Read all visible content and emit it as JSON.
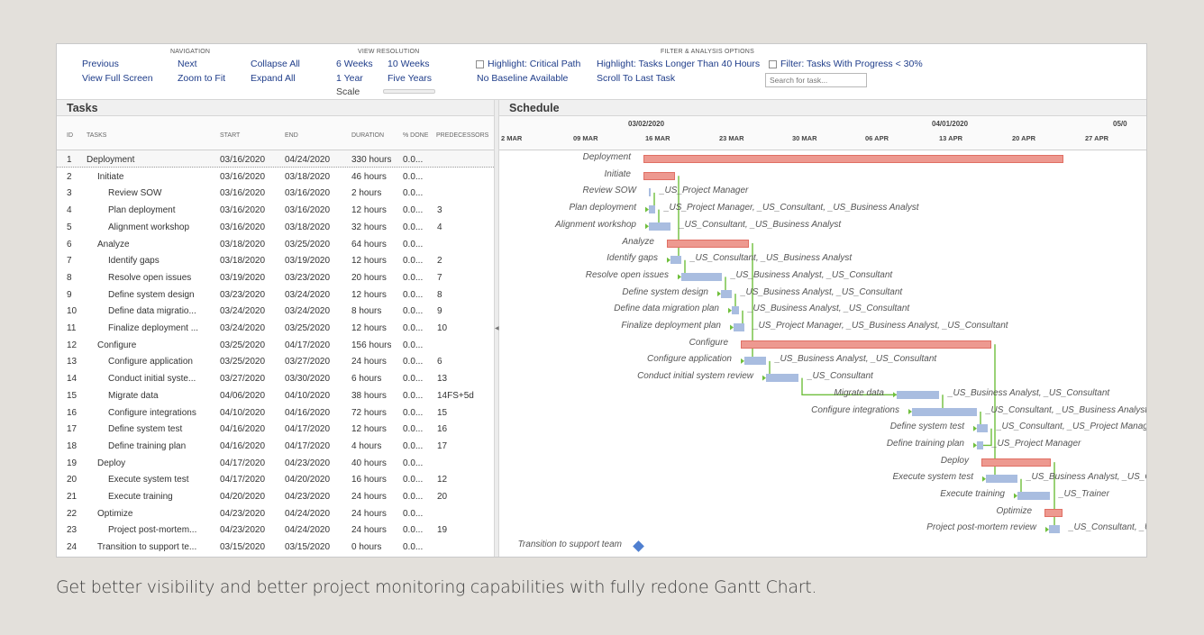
{
  "toolbar": {
    "navigation": {
      "title": "NAVIGATION",
      "previous": "Previous",
      "next": "Next",
      "collapse_all": "Collapse All",
      "view_full_screen": "View Full Screen",
      "zoom_to_fit": "Zoom to Fit",
      "expand_all": "Expand All"
    },
    "view_resolution": {
      "title": "VIEW RESOLUTION",
      "six_weeks": "6 Weeks",
      "ten_weeks": "10 Weeks",
      "one_year": "1 Year",
      "five_years": "Five Years",
      "scale": "Scale"
    },
    "filter": {
      "title": "FILTER & ANALYSIS OPTIONS",
      "highlight_critical": "Highlight: Critical Path",
      "highlight_longer": "Highlight: Tasks Longer Than 40 Hours",
      "filter_progress": "Filter: Tasks With Progress < 30%",
      "no_baseline": "No Baseline Available",
      "scroll_last": "Scroll To Last Task",
      "search_placeholder": "Search for task..."
    }
  },
  "tasks_panel": {
    "title": "Tasks",
    "columns": {
      "id": "ID",
      "tasks": "TASKS",
      "start": "START",
      "end": "END",
      "duration": "DURATION",
      "done": "% DONE",
      "pred": "PREDECESSORS"
    },
    "rows": [
      {
        "id": "1",
        "name": "Deployment",
        "start": "03/16/2020",
        "end": "04/24/2020",
        "duration": "330 hours",
        "done": "0.0...",
        "pred": "",
        "indent": 0
      },
      {
        "id": "2",
        "name": "Initiate",
        "start": "03/16/2020",
        "end": "03/18/2020",
        "duration": "46 hours",
        "done": "0.0...",
        "pred": "",
        "indent": 1
      },
      {
        "id": "3",
        "name": "Review SOW",
        "start": "03/16/2020",
        "end": "03/16/2020",
        "duration": "2 hours",
        "done": "0.0...",
        "pred": "",
        "indent": 2
      },
      {
        "id": "4",
        "name": "Plan deployment",
        "start": "03/16/2020",
        "end": "03/16/2020",
        "duration": "12 hours",
        "done": "0.0...",
        "pred": "3",
        "indent": 2
      },
      {
        "id": "5",
        "name": "Alignment workshop",
        "start": "03/16/2020",
        "end": "03/18/2020",
        "duration": "32 hours",
        "done": "0.0...",
        "pred": "4",
        "indent": 2
      },
      {
        "id": "6",
        "name": "Analyze",
        "start": "03/18/2020",
        "end": "03/25/2020",
        "duration": "64 hours",
        "done": "0.0...",
        "pred": "",
        "indent": 1
      },
      {
        "id": "7",
        "name": "Identify gaps",
        "start": "03/18/2020",
        "end": "03/19/2020",
        "duration": "12 hours",
        "done": "0.0...",
        "pred": "2",
        "indent": 2
      },
      {
        "id": "8",
        "name": "Resolve open issues",
        "start": "03/19/2020",
        "end": "03/23/2020",
        "duration": "20 hours",
        "done": "0.0...",
        "pred": "7",
        "indent": 2
      },
      {
        "id": "9",
        "name": "Define system design",
        "start": "03/23/2020",
        "end": "03/24/2020",
        "duration": "12 hours",
        "done": "0.0...",
        "pred": "8",
        "indent": 2
      },
      {
        "id": "10",
        "name": "Define data migratio...",
        "start": "03/24/2020",
        "end": "03/24/2020",
        "duration": "8 hours",
        "done": "0.0...",
        "pred": "9",
        "indent": 2
      },
      {
        "id": "11",
        "name": "Finalize deployment ...",
        "start": "03/24/2020",
        "end": "03/25/2020",
        "duration": "12 hours",
        "done": "0.0...",
        "pred": "10",
        "indent": 2
      },
      {
        "id": "12",
        "name": "Configure",
        "start": "03/25/2020",
        "end": "04/17/2020",
        "duration": "156 hours",
        "done": "0.0...",
        "pred": "",
        "indent": 1
      },
      {
        "id": "13",
        "name": "Configure application",
        "start": "03/25/2020",
        "end": "03/27/2020",
        "duration": "24 hours",
        "done": "0.0...",
        "pred": "6",
        "indent": 2
      },
      {
        "id": "14",
        "name": "Conduct initial syste...",
        "start": "03/27/2020",
        "end": "03/30/2020",
        "duration": "6 hours",
        "done": "0.0...",
        "pred": "13",
        "indent": 2
      },
      {
        "id": "15",
        "name": "Migrate data",
        "start": "04/06/2020",
        "end": "04/10/2020",
        "duration": "38 hours",
        "done": "0.0...",
        "pred": "14FS+5d",
        "indent": 2
      },
      {
        "id": "16",
        "name": "Configure integrations",
        "start": "04/10/2020",
        "end": "04/16/2020",
        "duration": "72 hours",
        "done": "0.0...",
        "pred": "15",
        "indent": 2
      },
      {
        "id": "17",
        "name": "Define system test",
        "start": "04/16/2020",
        "end": "04/17/2020",
        "duration": "12 hours",
        "done": "0.0...",
        "pred": "16",
        "indent": 2
      },
      {
        "id": "18",
        "name": "Define training plan",
        "start": "04/16/2020",
        "end": "04/17/2020",
        "duration": "4 hours",
        "done": "0.0...",
        "pred": "17",
        "indent": 2
      },
      {
        "id": "19",
        "name": "Deploy",
        "start": "04/17/2020",
        "end": "04/23/2020",
        "duration": "40 hours",
        "done": "0.0...",
        "pred": "",
        "indent": 1
      },
      {
        "id": "20",
        "name": "Execute system test",
        "start": "04/17/2020",
        "end": "04/20/2020",
        "duration": "16 hours",
        "done": "0.0...",
        "pred": "12",
        "indent": 2
      },
      {
        "id": "21",
        "name": "Execute training",
        "start": "04/20/2020",
        "end": "04/23/2020",
        "duration": "24 hours",
        "done": "0.0...",
        "pred": "20",
        "indent": 2
      },
      {
        "id": "22",
        "name": "Optimize",
        "start": "04/23/2020",
        "end": "04/24/2020",
        "duration": "24 hours",
        "done": "0.0...",
        "pred": "",
        "indent": 1
      },
      {
        "id": "23",
        "name": "Project post-mortem...",
        "start": "04/23/2020",
        "end": "04/24/2020",
        "duration": "24 hours",
        "done": "0.0...",
        "pred": "19",
        "indent": 2
      },
      {
        "id": "24",
        "name": "Transition to support te...",
        "start": "03/15/2020",
        "end": "03/15/2020",
        "duration": "0 hours",
        "done": "0.0...",
        "pred": "",
        "indent": 1
      }
    ]
  },
  "schedule_panel": {
    "title": "Schedule",
    "months": [
      "03/02/2020",
      "04/01/2020",
      "05/0"
    ],
    "weeks": [
      "2 MAR",
      "09 MAR",
      "16 MAR",
      "23 MAR",
      "30 MAR",
      "06 APR",
      "13 APR",
      "20 APR",
      "27 APR"
    ],
    "rows": [
      {
        "label": "Deployment",
        "type": "summary",
        "resources": ""
      },
      {
        "label": "Initiate",
        "type": "summary",
        "resources": ""
      },
      {
        "label": "Review SOW",
        "type": "task",
        "resources": "_US_Project Manager"
      },
      {
        "label": "Plan deployment",
        "type": "task",
        "resources": "_US_Project Manager, _US_Consultant, _US_Business Analyst"
      },
      {
        "label": "Alignment workshop",
        "type": "task",
        "resources": "_US_Consultant, _US_Business Analyst"
      },
      {
        "label": "Analyze",
        "type": "summary",
        "resources": ""
      },
      {
        "label": "Identify gaps",
        "type": "task",
        "resources": "_US_Consultant, _US_Business Analyst"
      },
      {
        "label": "Resolve open issues",
        "type": "task",
        "resources": "_US_Business Analyst, _US_Consultant"
      },
      {
        "label": "Define system design",
        "type": "task",
        "resources": "_US_Business Analyst, _US_Consultant"
      },
      {
        "label": "Define data migration plan",
        "type": "task",
        "resources": "_US_Business Analyst, _US_Consultant"
      },
      {
        "label": "Finalize deployment plan",
        "type": "task",
        "resources": "_US_Project Manager, _US_Business Analyst, _US_Consultant"
      },
      {
        "label": "Configure",
        "type": "summary",
        "resources": ""
      },
      {
        "label": "Configure application",
        "type": "task",
        "resources": "_US_Business Analyst, _US_Consultant"
      },
      {
        "label": "Conduct initial system review",
        "type": "task",
        "resources": "_US_Consultant"
      },
      {
        "label": "Migrate data",
        "type": "task",
        "resources": "_US_Business Analyst, _US_Consultant"
      },
      {
        "label": "Configure integrations",
        "type": "task",
        "resources": "_US_Consultant, _US_Business Analyst"
      },
      {
        "label": "Define system test",
        "type": "task",
        "resources": "_US_Consultant, _US_Project Manager"
      },
      {
        "label": "Define training plan",
        "type": "task",
        "resources": "_US_Project Manager"
      },
      {
        "label": "Deploy",
        "type": "summary",
        "resources": ""
      },
      {
        "label": "Execute system test",
        "type": "task",
        "resources": "_US_Business Analyst, _US_Consultant"
      },
      {
        "label": "Execute training",
        "type": "task",
        "resources": "_US_Trainer"
      },
      {
        "label": "Optimize",
        "type": "summary",
        "resources": ""
      },
      {
        "label": "Project post-mortem review",
        "type": "task",
        "resources": "_US_Consultant, _US_Business Analyst"
      },
      {
        "label": "Transition to support team",
        "type": "milestone",
        "resources": ""
      }
    ]
  },
  "caption": "Get better visibility and better project monitoring capabilities with fully redone Gantt Chart.",
  "colors": {
    "summary_bar": "#ed9990",
    "task_bar": "#a9bde0",
    "dependency_line": "#6fbf3c",
    "milestone": "#4f7fd0",
    "link_text": "#1f3d8a"
  }
}
